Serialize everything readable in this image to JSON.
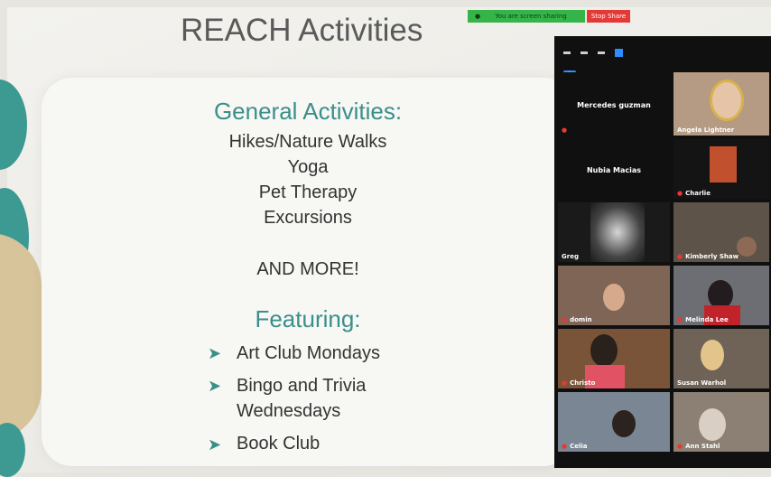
{
  "slide": {
    "title": "REACH Activities",
    "general_heading": "General Activities:",
    "general_items": [
      "Hikes/Nature Walks",
      "Yoga",
      "Pet Therapy",
      "Excursions"
    ],
    "more": "AND MORE!",
    "featuring_heading": "Featuring:",
    "featuring_items": [
      "Art Club Mondays",
      "Bingo and Trivia",
      "Wednesdays",
      "Book Club"
    ]
  },
  "zoom": {
    "share_message": "You are screen sharing",
    "stop_share_label": "Stop Share",
    "participants": [
      {
        "name": "Mercedes guzman",
        "video": false
      },
      {
        "name": "Angela Lightner",
        "video": true
      },
      {
        "name": "Nubia Macias",
        "video": false
      },
      {
        "name": "Charlie",
        "video": true
      },
      {
        "name": "Greg",
        "video": true
      },
      {
        "name": "Kimberly Shaw",
        "video": true
      },
      {
        "name": "domin",
        "video": true
      },
      {
        "name": "Melinda Lee",
        "video": true
      },
      {
        "name": "Christo",
        "video": true
      },
      {
        "name": "Susan Warhol",
        "video": true
      },
      {
        "name": "Celia",
        "video": true
      },
      {
        "name": "Ann Stahl",
        "video": true
      }
    ]
  },
  "colors": {
    "teal": "#3a8f8a",
    "share_green": "#35b44a",
    "stop_red": "#e53935",
    "zoom_blue": "#2d8cff"
  }
}
